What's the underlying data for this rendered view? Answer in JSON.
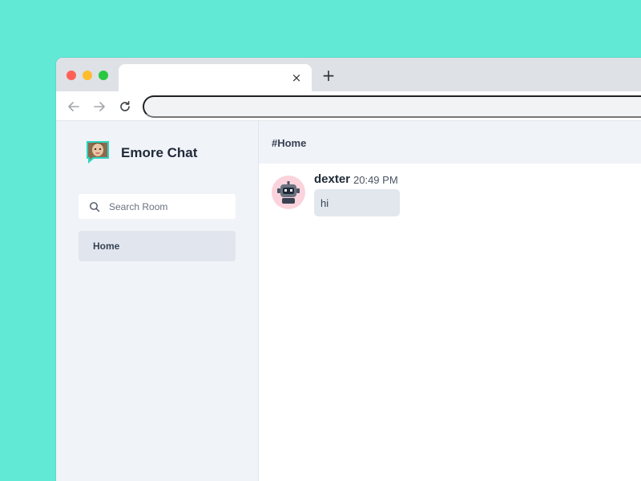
{
  "browser": {
    "tab_title": "",
    "tab_close_icon": "×",
    "new_tab_icon": "+",
    "address": ""
  },
  "sidebar": {
    "brand_title": "Emore Chat",
    "search_placeholder": "Search Room",
    "rooms": [
      {
        "label": "Home",
        "selected": true
      }
    ]
  },
  "main": {
    "room_title": "#Home",
    "messages": [
      {
        "author": "dexter",
        "time": "20:49 PM",
        "text": "hi"
      }
    ]
  },
  "colors": {
    "background": "#61e9d6",
    "sidebar": "#f0f3f8",
    "selected_room": "#e1e6ee",
    "bubble": "#e2e7ee",
    "avatar_bg": "#fbd3dc"
  }
}
